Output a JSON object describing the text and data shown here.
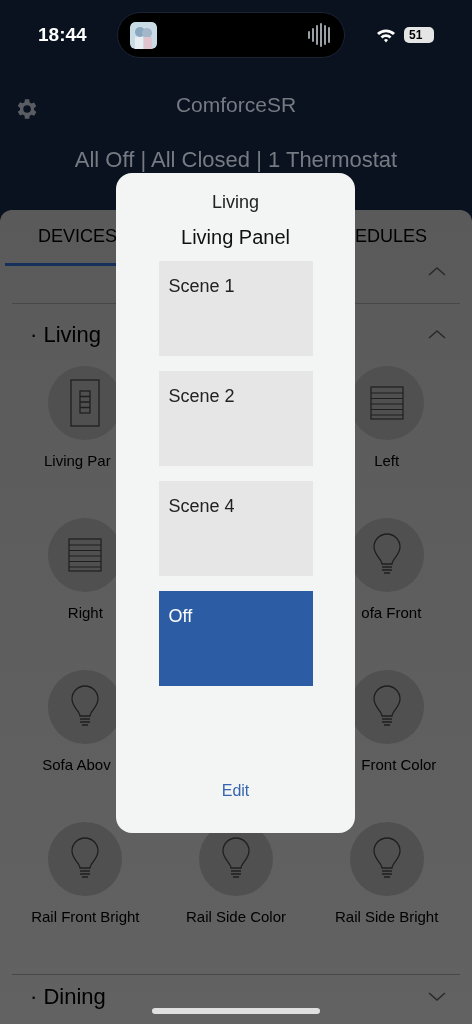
{
  "status_bar": {
    "time": "18:44",
    "battery": "51"
  },
  "header": {
    "title": "ComforceSR",
    "summary": "All Off | All Closed | 1 Thermostat"
  },
  "tabs": [
    {
      "label": "DEVICES",
      "selected": true
    },
    {
      "label": "EDULES",
      "selected": false
    }
  ],
  "sections": [
    {
      "title": "· Living",
      "expanded": true,
      "rows": [
        {
          "left": {
            "kind": "panel",
            "label": "Living Par",
            "cut_right": true
          },
          "right": {
            "kind": "shade",
            "label": "Left"
          }
        },
        {
          "left": {
            "kind": "shade",
            "label": "Right"
          },
          "right": {
            "kind": "bulb",
            "label": "ofa Front",
            "cut_left": true
          }
        },
        {
          "left": {
            "kind": "bulb",
            "label": "Sofa Abov",
            "cut_right": true
          },
          "right": {
            "kind": "bulb",
            "label": "Front Color",
            "cut_left": true
          }
        },
        {
          "left": {
            "kind": "bulb",
            "label": "Rail Front Bright"
          },
          "center": {
            "kind": "bulb",
            "label": "Rail Side Color"
          },
          "right": {
            "kind": "bulb",
            "label": "Rail Side Bright"
          }
        }
      ]
    },
    {
      "title": "· Dining",
      "expanded": false
    }
  ],
  "dialog": {
    "title": "Living",
    "subtitle": "Living Panel",
    "scenes": [
      {
        "label": "Scene 1",
        "selected": false
      },
      {
        "label": "Scene 2",
        "selected": false
      },
      {
        "label": "Scene 4",
        "selected": false
      },
      {
        "label": "Off",
        "selected": true
      }
    ],
    "action": "Edit"
  }
}
